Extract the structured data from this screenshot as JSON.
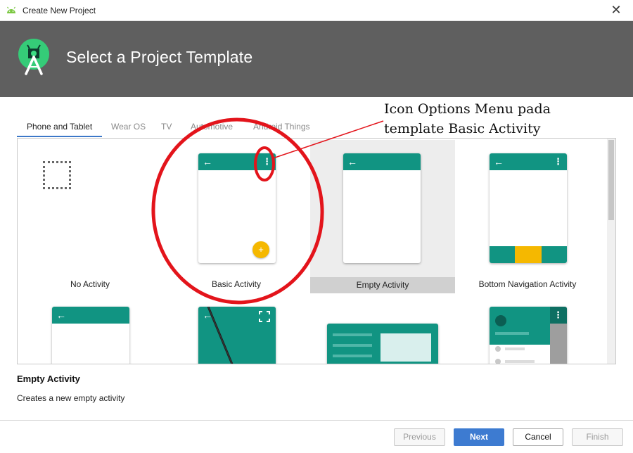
{
  "window": {
    "title": "Create New Project",
    "close_glyph": "✕",
    "icon": "android-icon"
  },
  "header": {
    "title": "Select a Project Template",
    "logo": "android-studio-logo"
  },
  "tabs": [
    {
      "label": "Phone and Tablet",
      "active": true
    },
    {
      "label": "Wear OS",
      "active": false
    },
    {
      "label": "TV",
      "active": false
    },
    {
      "label": "Automotive",
      "active": false
    },
    {
      "label": "Android Things",
      "active": false
    }
  ],
  "templates": [
    {
      "label": "No Activity"
    },
    {
      "label": "Basic Activity"
    },
    {
      "label": "Empty Activity",
      "selected": true
    },
    {
      "label": "Bottom Navigation Activity"
    }
  ],
  "glyphs": {
    "back": "←",
    "more": "⋮",
    "fab_plus": "+"
  },
  "selection": {
    "title": "Empty Activity",
    "description": "Creates a new empty activity"
  },
  "buttons": {
    "previous": "Previous",
    "next": "Next",
    "cancel": "Cancel",
    "finish": "Finish"
  },
  "annotation": {
    "line1": "Icon Options Menu pada",
    "line2": "template Basic Activity"
  },
  "colors": {
    "header_bg": "#5f5f5f",
    "teal": "#119482",
    "accent_yellow": "#f5b800",
    "primary_button": "#3d7bd1",
    "annotation_red": "#e3141b",
    "tab_underline": "#3c78c8"
  }
}
